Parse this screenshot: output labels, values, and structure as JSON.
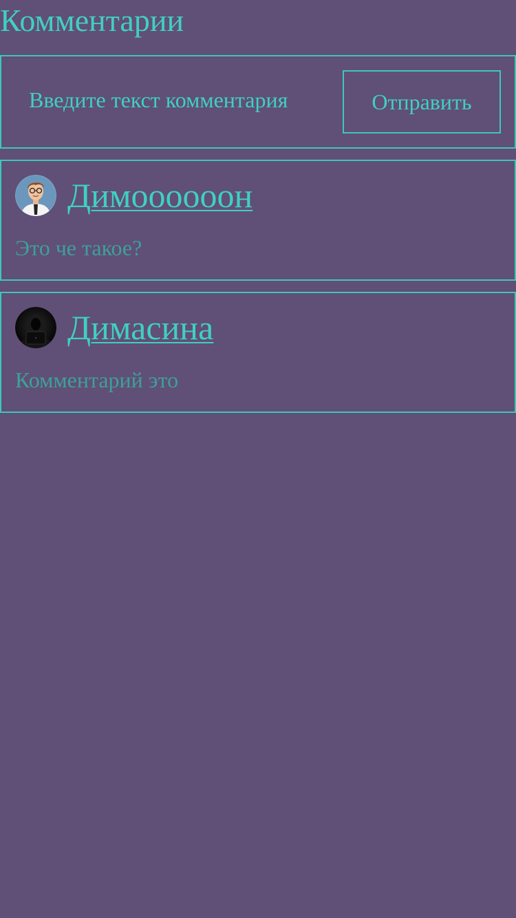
{
  "page": {
    "title": "Комментарии"
  },
  "form": {
    "placeholder": "Введите текст комментария",
    "submit_label": "Отправить"
  },
  "comments": [
    {
      "author": "Димоооооон",
      "text": "Это че такое?",
      "avatar_icon": "cartoon-man-with-glasses-avatar"
    },
    {
      "author": "Димасина",
      "text": "Комментарий это",
      "avatar_icon": "hooded-hacker-avatar"
    }
  ],
  "colors": {
    "background": "#604f76",
    "accent": "#40d0c0",
    "border": "#3ec8b9",
    "comment_text": "#3ea09a"
  }
}
